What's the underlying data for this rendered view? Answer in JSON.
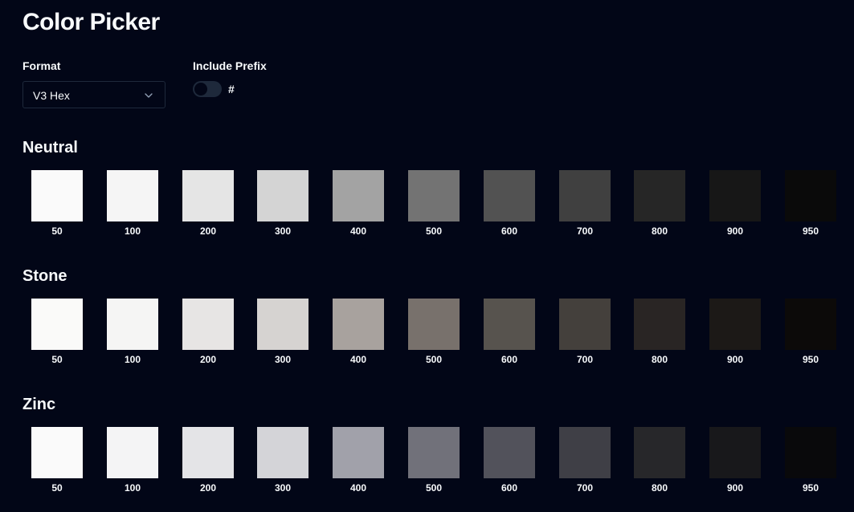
{
  "header": {
    "title": "Color Picker"
  },
  "controls": {
    "format_label": "Format",
    "format_value": "V3 Hex",
    "prefix_label": "Include Prefix",
    "prefix_char": "#",
    "prefix_enabled": false
  },
  "palettes": [
    {
      "name": "Neutral",
      "swatches": [
        {
          "label": "50",
          "color": "#fafafa"
        },
        {
          "label": "100",
          "color": "#f5f5f5"
        },
        {
          "label": "200",
          "color": "#e5e5e5"
        },
        {
          "label": "300",
          "color": "#d4d4d4"
        },
        {
          "label": "400",
          "color": "#a3a3a3"
        },
        {
          "label": "500",
          "color": "#737373"
        },
        {
          "label": "600",
          "color": "#525252"
        },
        {
          "label": "700",
          "color": "#404040"
        },
        {
          "label": "800",
          "color": "#262626"
        },
        {
          "label": "900",
          "color": "#171717"
        },
        {
          "label": "950",
          "color": "#0a0a0a"
        }
      ]
    },
    {
      "name": "Stone",
      "swatches": [
        {
          "label": "50",
          "color": "#fafaf9"
        },
        {
          "label": "100",
          "color": "#f5f5f4"
        },
        {
          "label": "200",
          "color": "#e7e5e4"
        },
        {
          "label": "300",
          "color": "#d6d3d1"
        },
        {
          "label": "400",
          "color": "#a8a29e"
        },
        {
          "label": "500",
          "color": "#78716c"
        },
        {
          "label": "600",
          "color": "#57534e"
        },
        {
          "label": "700",
          "color": "#44403c"
        },
        {
          "label": "800",
          "color": "#292524"
        },
        {
          "label": "900",
          "color": "#1c1917"
        },
        {
          "label": "950",
          "color": "#0c0a09"
        }
      ]
    },
    {
      "name": "Zinc",
      "swatches": [
        {
          "label": "50",
          "color": "#fafafa"
        },
        {
          "label": "100",
          "color": "#f4f4f5"
        },
        {
          "label": "200",
          "color": "#e4e4e7"
        },
        {
          "label": "300",
          "color": "#d4d4d8"
        },
        {
          "label": "400",
          "color": "#a1a1aa"
        },
        {
          "label": "500",
          "color": "#71717a"
        },
        {
          "label": "600",
          "color": "#52525b"
        },
        {
          "label": "700",
          "color": "#3f3f46"
        },
        {
          "label": "800",
          "color": "#27272a"
        },
        {
          "label": "900",
          "color": "#18181b"
        },
        {
          "label": "950",
          "color": "#09090b"
        }
      ]
    }
  ],
  "theme": {
    "background": "#020617",
    "text": "#f8fafc",
    "border": "#1e293b"
  }
}
